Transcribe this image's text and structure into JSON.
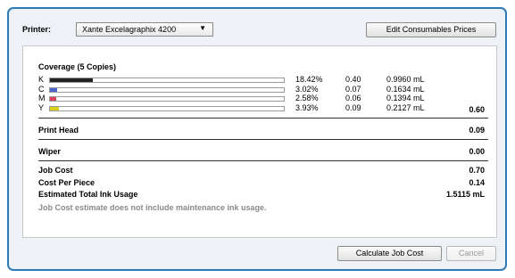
{
  "printer": {
    "label": "Printer:",
    "selected": "Xante Excelagraphix 4200",
    "arrow_icon": "▼"
  },
  "buttons": {
    "edit_prices": "Edit Consumables Prices",
    "calculate": "Calculate Job Cost",
    "cancel": "Cancel"
  },
  "coverage": {
    "title": "Coverage (5 Copies)",
    "rows": [
      {
        "channel": "K",
        "percent": "18.42%",
        "fraction": 0.1842,
        "amount": "0.40",
        "volume": "0.9960 mL",
        "color": "#222222"
      },
      {
        "channel": "C",
        "percent": "3.02%",
        "fraction": 0.0302,
        "amount": "0.07",
        "volume": "0.1634 mL",
        "color": "#4a63c8"
      },
      {
        "channel": "M",
        "percent": "2.58%",
        "fraction": 0.0258,
        "amount": "0.06",
        "volume": "0.1394 mL",
        "color": "#d9405a"
      },
      {
        "channel": "Y",
        "percent": "3.93%",
        "fraction": 0.0393,
        "amount": "0.09",
        "volume": "0.2127 mL",
        "color": "#d8cf1a"
      }
    ],
    "total": "0.60"
  },
  "print_head": {
    "label": "Print Head",
    "value": "0.09"
  },
  "wiper": {
    "label": "Wiper",
    "value": "0.00"
  },
  "summary": {
    "job_cost_label": "Job Cost",
    "job_cost": "0.70",
    "cost_per_piece_label": "Cost Per Piece",
    "cost_per_piece": "0.14",
    "ink_usage_label": "Estimated Total Ink Usage",
    "ink_usage": "1.5115 mL",
    "note": "Job Cost estimate does not include maintenance ink usage."
  }
}
